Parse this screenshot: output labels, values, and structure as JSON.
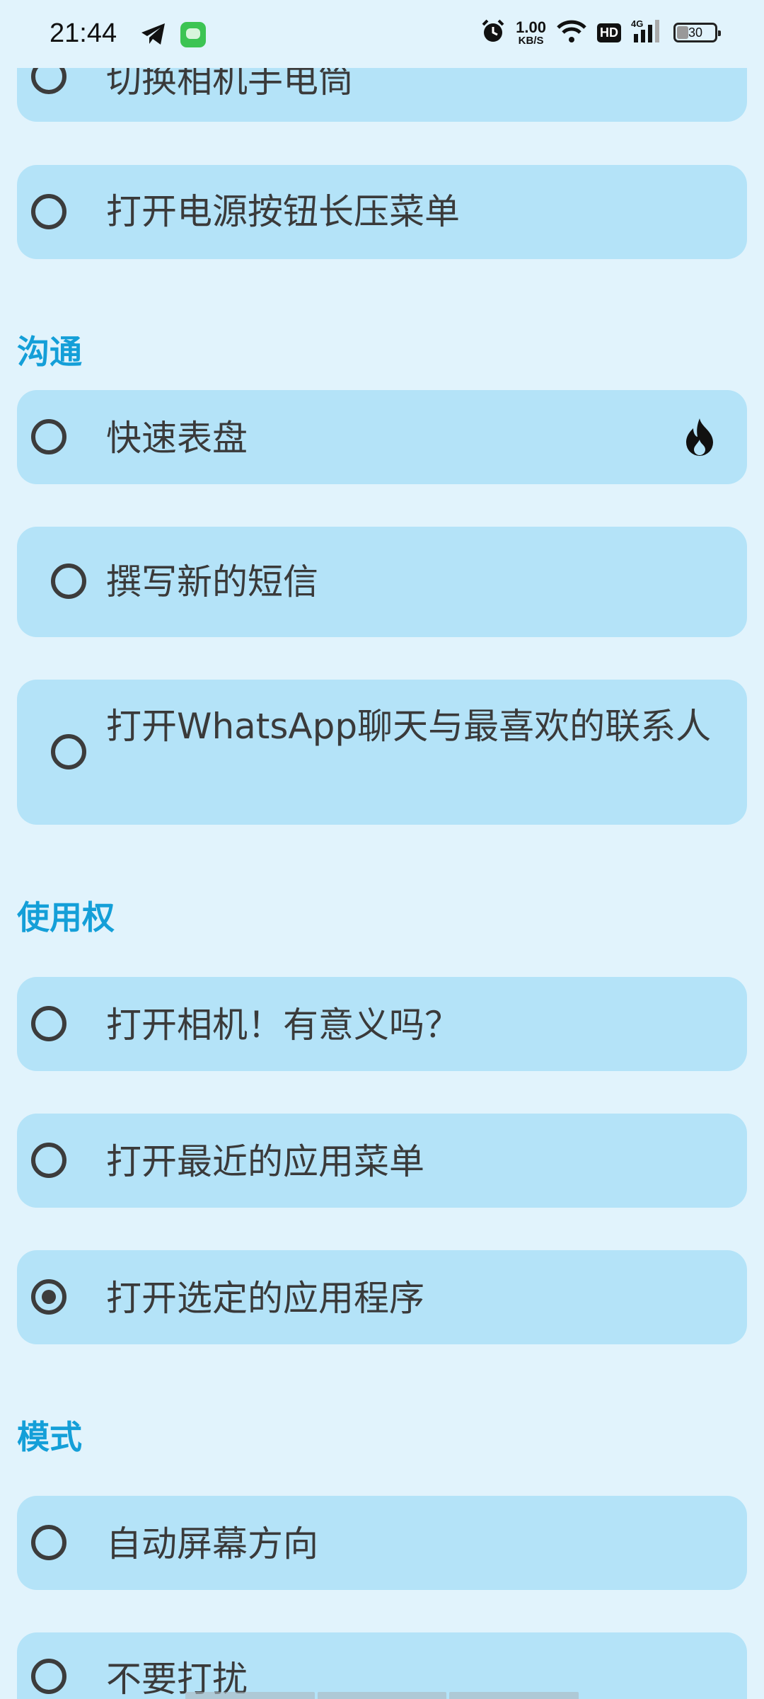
{
  "status_bar": {
    "time": "21:44",
    "net_speed_value": "1.00",
    "net_speed_unit": "KB/S",
    "hd": "HD",
    "network": "4G",
    "battery": "30",
    "battery_level": 0.3
  },
  "items": {
    "flashlight": "切换相机手电筒",
    "power_menu": "打开电源按钮长压菜单",
    "quick_dial": "快速表盘",
    "new_sms": "撰写新的短信",
    "whatsapp": "打开WhatsApp聊天与最喜欢的联系人",
    "camera": "打开相机！有意义吗？",
    "recent_apps": "打开最近的应用菜单",
    "selected_app": "打开选定的应用程序",
    "auto_rotate": "自动屏幕方向",
    "dnd": "不要打扰"
  },
  "sections": {
    "communication": "沟通",
    "usage": "使用权",
    "mode": "模式"
  },
  "selected_item": "selected_app",
  "colors": {
    "background": "#e1f3fc",
    "card": "#b4e3f8",
    "section_title": "#149fd8",
    "text": "#3a3a3a"
  }
}
